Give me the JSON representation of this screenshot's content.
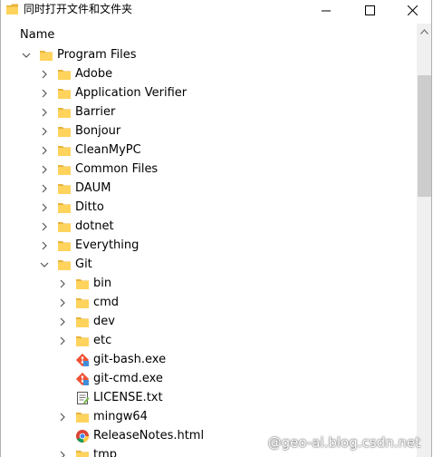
{
  "window": {
    "title": "同时打开文件和文件夹"
  },
  "header": {
    "column_name": "Name"
  },
  "tree": [
    {
      "label": "Program Files",
      "level": 0,
      "icon": "folder-icon",
      "expander": "expanded"
    },
    {
      "label": "Adobe",
      "level": 1,
      "icon": "folder-icon",
      "expander": "collapsed"
    },
    {
      "label": "Application Verifier",
      "level": 1,
      "icon": "folder-icon",
      "expander": "collapsed"
    },
    {
      "label": "Barrier",
      "level": 1,
      "icon": "folder-icon",
      "expander": "collapsed"
    },
    {
      "label": "Bonjour",
      "level": 1,
      "icon": "folder-icon",
      "expander": "collapsed"
    },
    {
      "label": "CleanMyPC",
      "level": 1,
      "icon": "folder-icon",
      "expander": "collapsed"
    },
    {
      "label": "Common Files",
      "level": 1,
      "icon": "folder-icon",
      "expander": "collapsed"
    },
    {
      "label": "DAUM",
      "level": 1,
      "icon": "folder-icon",
      "expander": "collapsed"
    },
    {
      "label": "Ditto",
      "level": 1,
      "icon": "folder-icon",
      "expander": "collapsed"
    },
    {
      "label": "dotnet",
      "level": 1,
      "icon": "folder-icon",
      "expander": "collapsed"
    },
    {
      "label": "Everything",
      "level": 1,
      "icon": "folder-icon",
      "expander": "collapsed"
    },
    {
      "label": "Git",
      "level": 1,
      "icon": "folder-icon",
      "expander": "expanded"
    },
    {
      "label": "bin",
      "level": 2,
      "icon": "folder-icon",
      "expander": "collapsed"
    },
    {
      "label": "cmd",
      "level": 2,
      "icon": "folder-icon",
      "expander": "collapsed"
    },
    {
      "label": "dev",
      "level": 2,
      "icon": "folder-icon",
      "expander": "collapsed"
    },
    {
      "label": "etc",
      "level": 2,
      "icon": "folder-icon",
      "expander": "collapsed"
    },
    {
      "label": "git-bash.exe",
      "level": 2,
      "icon": "git-icon",
      "expander": "none"
    },
    {
      "label": "git-cmd.exe",
      "level": 2,
      "icon": "git-icon",
      "expander": "none"
    },
    {
      "label": "LICENSE.txt",
      "level": 2,
      "icon": "text-file-icon",
      "expander": "none"
    },
    {
      "label": "mingw64",
      "level": 2,
      "icon": "folder-icon",
      "expander": "collapsed"
    },
    {
      "label": "ReleaseNotes.html",
      "level": 2,
      "icon": "chrome-icon",
      "expander": "none"
    },
    {
      "label": "tmp",
      "level": 2,
      "icon": "folder-icon",
      "expander": "collapsed"
    }
  ],
  "watermark": "@geo-ai.blog.csdn.net",
  "colors": {
    "folder": "#ffd35c",
    "folder_dark": "#e8b33a",
    "arrow": "#555555",
    "scrollbar_track": "#f0f0f0",
    "scrollbar_thumb": "#cdcdcd"
  }
}
